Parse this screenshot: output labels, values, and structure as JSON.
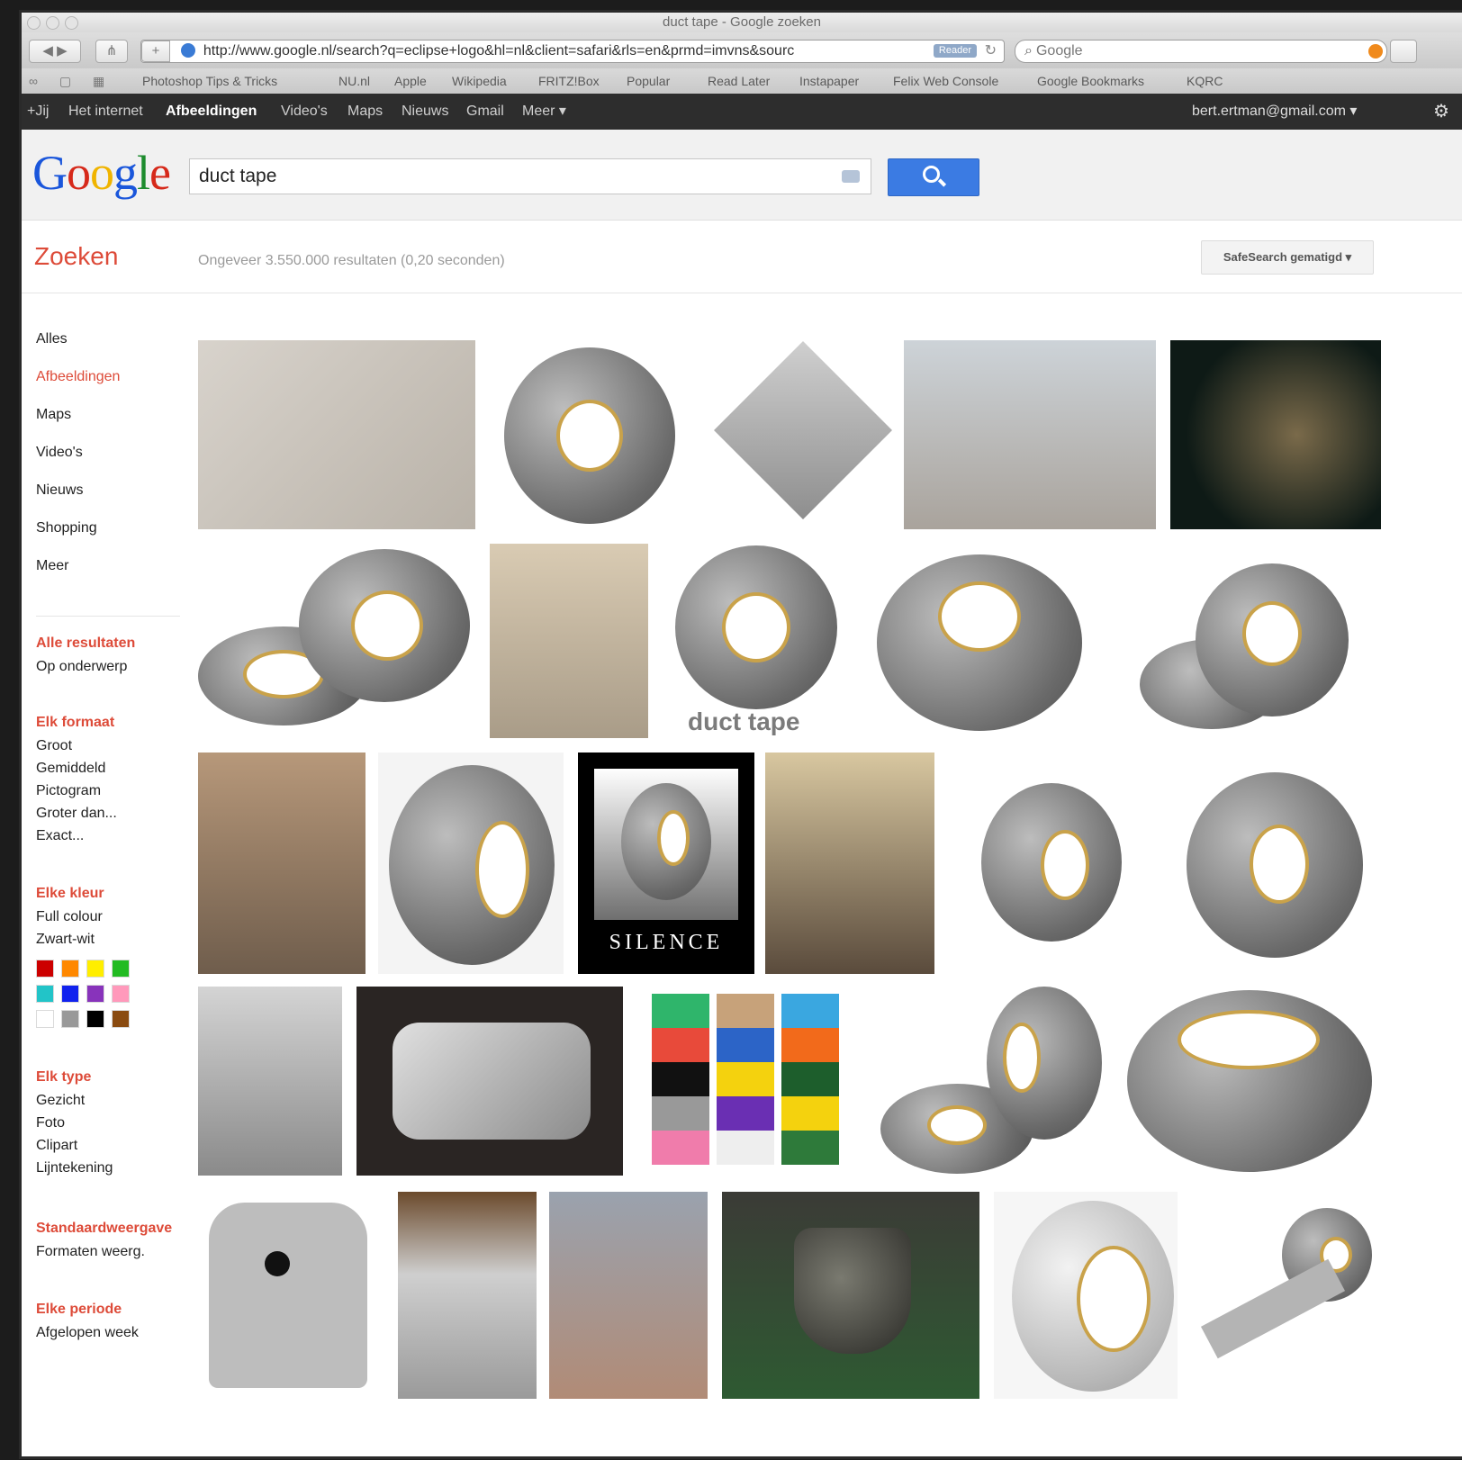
{
  "window": {
    "title": "duct tape - Google zoeken"
  },
  "toolbar": {
    "url": "http://www.google.nl/search?q=eclipse+logo&hl=nl&client=safari&rls=en&prmd=imvns&sourc",
    "reader_label": "Reader",
    "search_placeholder": "Google"
  },
  "bookmarks": [
    "Photoshop Tips & Tricks",
    "NU.nl",
    "Apple",
    "Wikipedia",
    "FRITZ!Box",
    "Popular",
    "Read Later",
    "Instapaper",
    "Felix Web Console",
    "Google Bookmarks",
    "KQRC"
  ],
  "gbar": {
    "items": [
      "+Jij",
      "Het internet",
      "Afbeeldingen",
      "Video's",
      "Maps",
      "Nieuws",
      "Gmail",
      "Meer"
    ],
    "active": "Afbeeldingen",
    "email": "bert.ertman@gmail.com"
  },
  "search": {
    "query": "duct tape"
  },
  "results": {
    "title": "Zoeken",
    "stats": "Ongeveer 3.550.000 resultaten (0,20 seconden)",
    "safesearch": "SafeSearch gematigd"
  },
  "sidebar": {
    "nav": [
      "Alles",
      "Afbeeldingen",
      "Maps",
      "Video's",
      "Nieuws",
      "Shopping",
      "Meer"
    ],
    "sections": [
      {
        "heading": "Alle resultaten",
        "items": [
          "Op onderwerp"
        ]
      },
      {
        "heading": "Elk formaat",
        "items": [
          "Groot",
          "Gemiddeld",
          "Pictogram",
          "Groter dan...",
          "Exact..."
        ]
      },
      {
        "heading": "Elke kleur",
        "items": [
          "Full colour",
          "Zwart-wit"
        ]
      },
      {
        "heading": "Elk type",
        "items": [
          "Gezicht",
          "Foto",
          "Clipart",
          "Lijntekening"
        ]
      },
      {
        "heading": "Standaardweergave",
        "items": [
          "Formaten weerg."
        ]
      },
      {
        "heading": "Elke periode",
        "items": [
          "Afgelopen week"
        ]
      }
    ],
    "colors": [
      "#cc0000",
      "#ff8800",
      "#ffee00",
      "#22bb22",
      "#22c4c8",
      "#1122ee",
      "#8833bb",
      "#ff99bb",
      "#ffffff",
      "#999999",
      "#000000",
      "#8a4b10"
    ]
  },
  "images": {
    "caption_duct_tape": "duct tape",
    "caption_silence": "SILENCE"
  }
}
